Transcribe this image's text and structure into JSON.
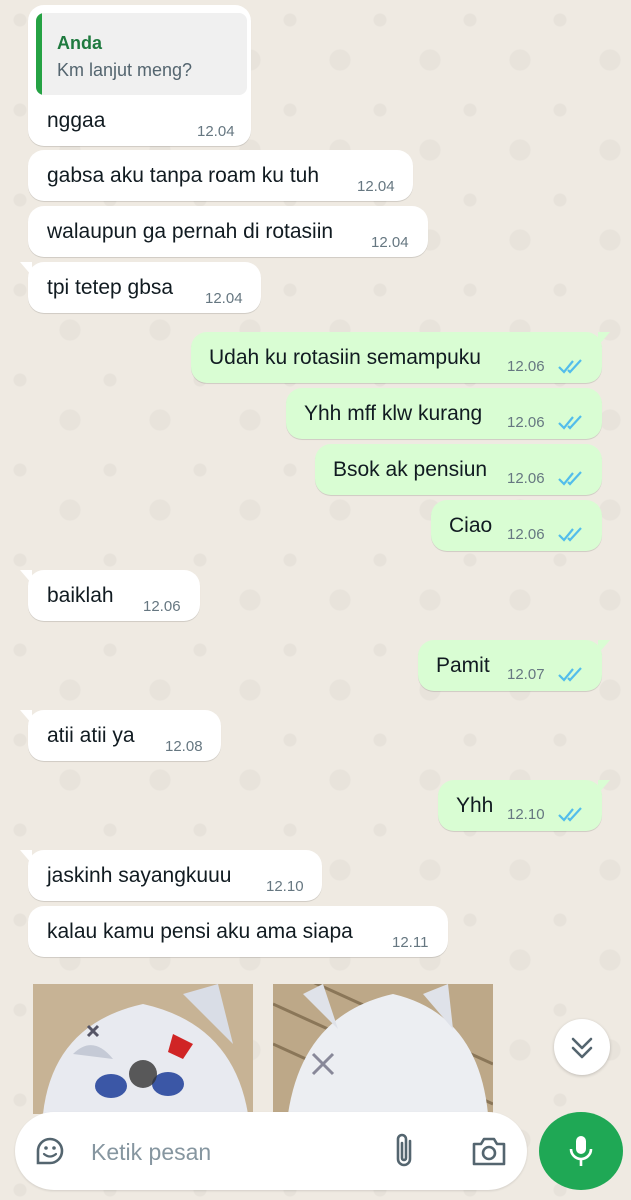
{
  "chat": {
    "messages": [
      {
        "dir": "in",
        "text": "nggaa",
        "time": "12.04",
        "reply_to": {
          "author": "Anda",
          "text": "Km lanjut meng?"
        }
      },
      {
        "dir": "in",
        "text": "gabsa aku tanpa roam ku tuh",
        "time": "12.04"
      },
      {
        "dir": "in",
        "text": "walaupun ga pernah di rotasiin",
        "time": "12.04"
      },
      {
        "dir": "in",
        "text": "tpi tetep gbsa",
        "time": "12.04"
      },
      {
        "dir": "out",
        "text": "Udah ku rotasiin semampuku",
        "time": "12.06",
        "status": "read"
      },
      {
        "dir": "out",
        "text": "Yhh mff klw kurang",
        "time": "12.06",
        "status": "read"
      },
      {
        "dir": "out",
        "text": "Bsok ak pensiun",
        "time": "12.06",
        "status": "read"
      },
      {
        "dir": "out",
        "text": "Ciao",
        "time": "12.06",
        "status": "read"
      },
      {
        "dir": "in",
        "text": "baiklah",
        "time": "12.06"
      },
      {
        "dir": "out",
        "text": "Pamit",
        "time": "12.07",
        "status": "read"
      },
      {
        "dir": "in",
        "text": "atii atii ya",
        "time": "12.08"
      },
      {
        "dir": "out",
        "text": "Yhh",
        "time": "12.10",
        "status": "read"
      },
      {
        "dir": "in",
        "text": "jaskinh sayangkuuu",
        "time": "12.10"
      },
      {
        "dir": "in",
        "text": "kalau kamu pensi aku ama siapa",
        "time": "12.11"
      }
    ],
    "images": [
      "anime-girl-sticker-1",
      "anime-girl-sticker-2"
    ]
  },
  "composer": {
    "placeholder": "Ketik pesan",
    "icons": {
      "sticker": "sticker-icon",
      "attach": "paperclip-icon",
      "camera": "camera-icon",
      "mic": "microphone-icon",
      "scroll": "double-chevron-down-icon"
    }
  },
  "colors": {
    "background": "#efeae2",
    "incoming_bubble": "#ffffff",
    "outgoing_bubble": "#d9fdd3",
    "read_ticks": "#53bdeb",
    "accent_green": "#1fa855"
  }
}
